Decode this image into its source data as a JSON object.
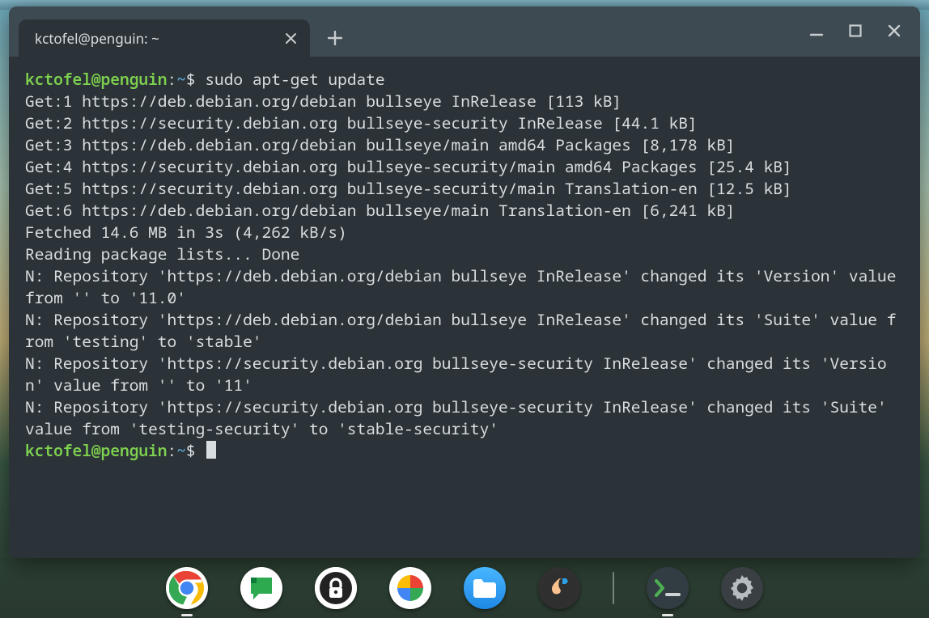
{
  "window": {
    "tab_title": "kctofel@penguin: ~"
  },
  "prompt": {
    "user": "kctofel@penguin",
    "path": "~",
    "sep1": ":",
    "sep2": "$ "
  },
  "cmd1": "sudo apt-get update",
  "output": [
    "Get:1 https://deb.debian.org/debian bullseye InRelease [113 kB]",
    "Get:2 https://security.debian.org bullseye-security InRelease [44.1 kB]",
    "Get:3 https://deb.debian.org/debian bullseye/main amd64 Packages [8,178 kB]",
    "Get:4 https://security.debian.org bullseye-security/main amd64 Packages [25.4 kB]",
    "Get:5 https://security.debian.org bullseye-security/main Translation-en [12.5 kB]",
    "Get:6 https://deb.debian.org/debian bullseye/main Translation-en [6,241 kB]",
    "Fetched 14.6 MB in 3s (4,262 kB/s)",
    "Reading package lists... Done",
    "N: Repository 'https://deb.debian.org/debian bullseye InRelease' changed its 'Version' value from '' to '11.0'",
    "N: Repository 'https://deb.debian.org/debian bullseye InRelease' changed its 'Suite' value from 'testing' to 'stable'",
    "N: Repository 'https://security.debian.org bullseye-security InRelease' changed its 'Version' value from '' to '11'",
    "N: Repository 'https://security.debian.org bullseye-security InRelease' changed its 'Suite' value from 'testing-security' to 'stable-security'"
  ],
  "shelf": {
    "apps": [
      {
        "name": "chrome",
        "running": true
      },
      {
        "name": "chat",
        "running": false
      },
      {
        "name": "secrets",
        "running": false
      },
      {
        "name": "photos",
        "running": false
      },
      {
        "name": "files",
        "running": false
      },
      {
        "name": "muscle",
        "running": false
      }
    ],
    "right_apps": [
      {
        "name": "terminal",
        "running": true
      },
      {
        "name": "settings",
        "running": false
      }
    ]
  }
}
